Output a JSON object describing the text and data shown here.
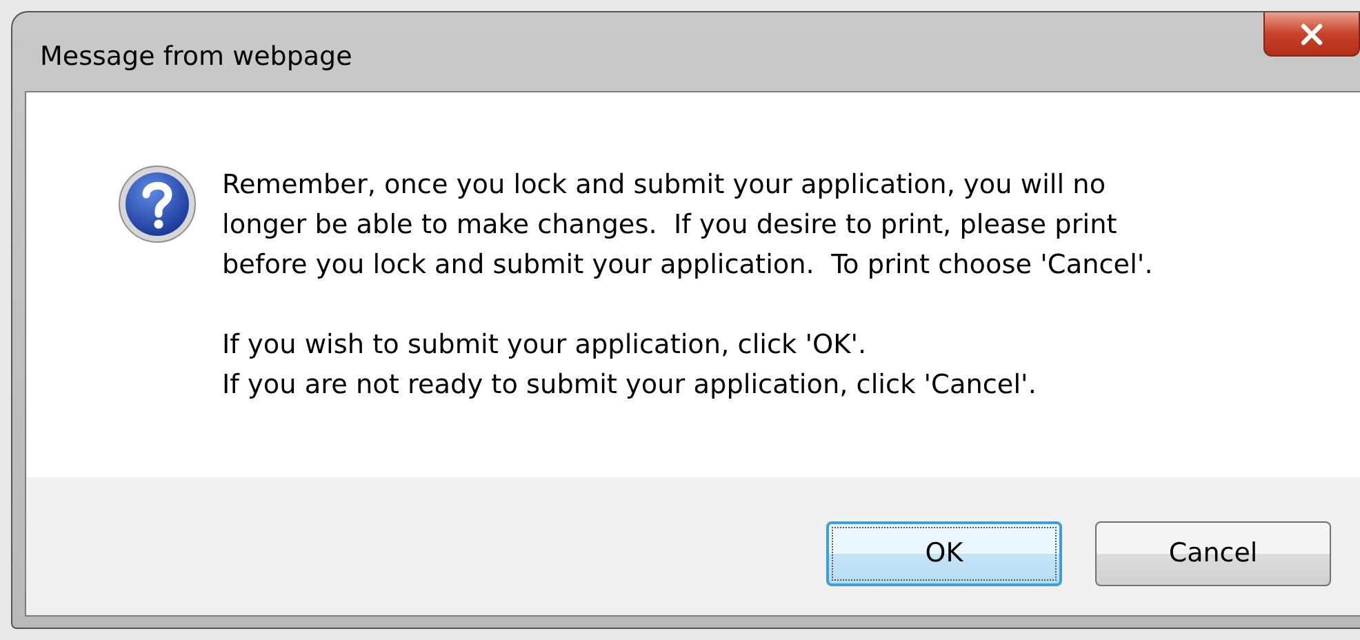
{
  "window": {
    "title": "Message from webpage"
  },
  "message": {
    "kind": "question",
    "paragraphs": [
      {
        "lines": [
          "Remember, once you lock and submit your application, you will no",
          "longer be able to make changes.  If you desire to print, please print",
          "before you lock and submit your application.  To print choose 'Cancel'."
        ]
      },
      {
        "lines": [
          "If you wish to submit your application, click 'OK'.",
          "If you are not ready to submit your application, click 'Cancel'."
        ]
      }
    ]
  },
  "buttons": [
    {
      "label": "OK",
      "default": true
    },
    {
      "label": "Cancel",
      "default": false
    }
  ]
}
